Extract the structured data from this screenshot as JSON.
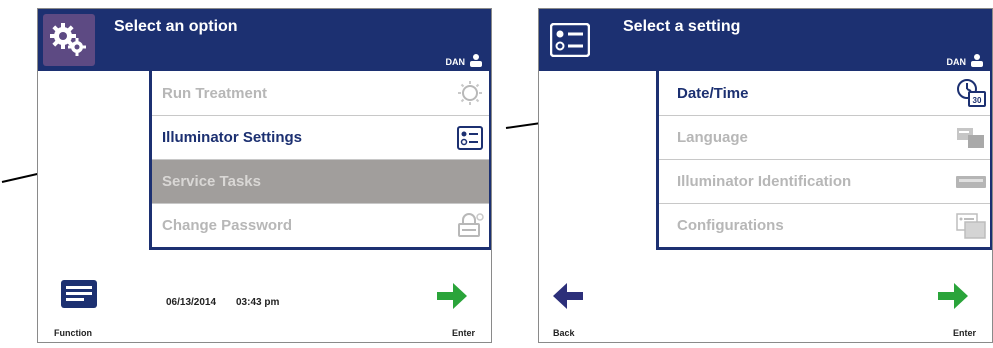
{
  "left": {
    "header": {
      "title": "Select an option",
      "user": "DAN"
    },
    "menu": [
      {
        "label": "Run Treatment",
        "state": "dim",
        "icon": "run-treatment-icon"
      },
      {
        "label": "Illuminator Settings",
        "state": "active",
        "icon": "settings-list-icon"
      },
      {
        "label": "Service Tasks",
        "state": "selected",
        "icon": "none"
      },
      {
        "label": "Change Password",
        "state": "dim",
        "icon": "lock-icon"
      }
    ],
    "footer": {
      "function_label": "Function",
      "date": "06/13/2014",
      "time": "03:43 pm",
      "enter_label": "Enter"
    }
  },
  "right": {
    "header": {
      "title": "Select a setting",
      "user": "DAN"
    },
    "menu": [
      {
        "label": "Date/Time",
        "state": "active",
        "icon": "clock-calendar-icon",
        "icon_text": "30"
      },
      {
        "label": "Language",
        "state": "dim",
        "icon": "language-icon"
      },
      {
        "label": "Illuminator Identification",
        "state": "dim",
        "icon": "device-icon"
      },
      {
        "label": "Configurations",
        "state": "dim",
        "icon": "configurations-icon"
      }
    ],
    "footer": {
      "back_label": "Back",
      "enter_label": "Enter"
    }
  },
  "colors": {
    "header": "#1c3071",
    "enter_arrow": "#2aa43a",
    "back_arrow": "#2c2f7a",
    "selected_row": "#a19e9c"
  }
}
